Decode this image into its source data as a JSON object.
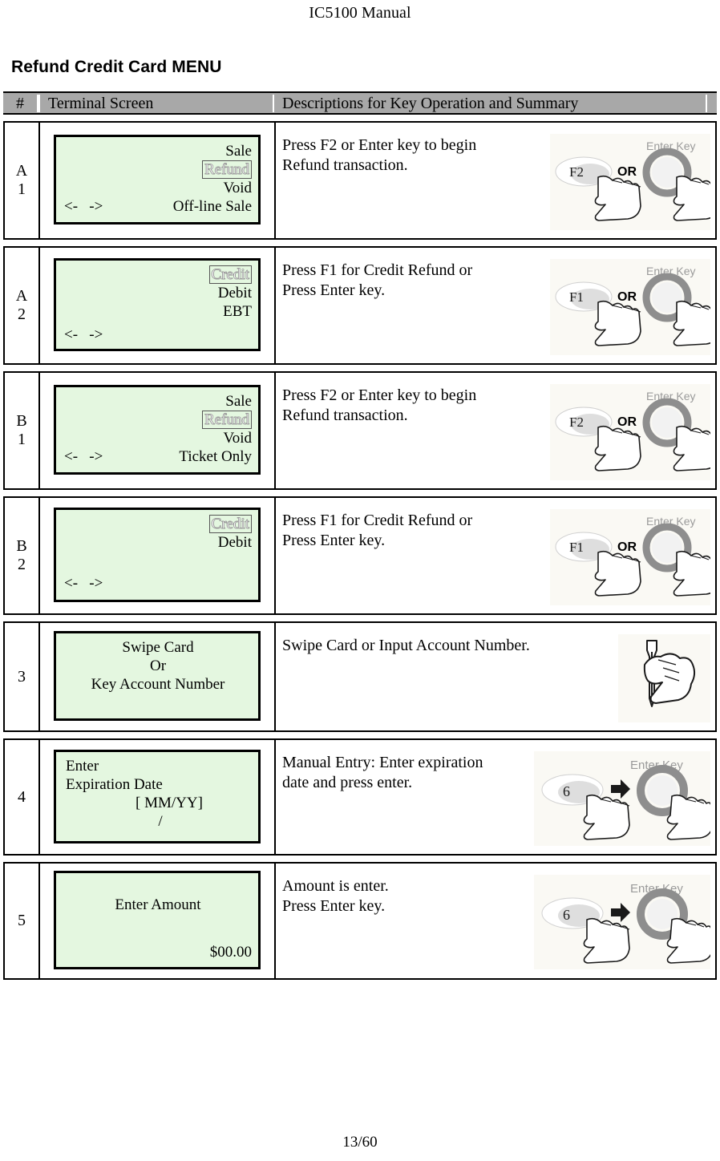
{
  "document": {
    "header_title": "IC5100 Manual",
    "page_title": "Refund Credit Card MENU",
    "footer": "13/60"
  },
  "table": {
    "columns": {
      "num": "#",
      "screen": "Terminal Screen",
      "description": "Descriptions for Key Operation and Summary"
    },
    "rows": [
      {
        "id": "A1",
        "num_line1": "A",
        "num_line2": "1",
        "screen": {
          "line1": "Sale",
          "line2_selected": "Refund",
          "line3": "Void",
          "nav_arrows": "<-   ->",
          "nav_label": "Off-line Sale"
        },
        "description": "Press F2 or Enter key to begin\nRefund transaction.",
        "illustration": {
          "type": "key-or-enter",
          "key_label": "F2",
          "connector": "OR",
          "enter_label": "Enter Key"
        }
      },
      {
        "id": "A2",
        "num_line1": "A",
        "num_line2": "2",
        "screen": {
          "line1_selected": "Credit",
          "line2": "Debit",
          "line3": "EBT",
          "nav_arrows": "<-   ->",
          "nav_label": ""
        },
        "description": "Press F1 for Credit Refund or\nPress Enter key.",
        "illustration": {
          "type": "key-or-enter",
          "key_label": "F1",
          "connector": "OR",
          "enter_label": "Enter Key"
        }
      },
      {
        "id": "B1",
        "num_line1": "B",
        "num_line2": "1",
        "screen": {
          "line1": "Sale",
          "line2_selected": "Refund",
          "line3": "Void",
          "nav_arrows": "<-   ->",
          "nav_label": "Ticket Only"
        },
        "description": "Press F2 or Enter key to begin\nRefund transaction.",
        "illustration": {
          "type": "key-or-enter",
          "key_label": "F2",
          "connector": "OR",
          "enter_label": "Enter Key"
        }
      },
      {
        "id": "B2",
        "num_line1": "B",
        "num_line2": "2",
        "screen": {
          "line1_selected": "Credit",
          "line2": "Debit",
          "line3": "",
          "nav_arrows": "<-   ->",
          "nav_label": ""
        },
        "description": "Press F1 for Credit Refund or\nPress Enter key.",
        "illustration": {
          "type": "key-or-enter",
          "key_label": "F1",
          "connector": "OR",
          "enter_label": "Enter Key"
        }
      },
      {
        "id": "3",
        "num_line1": "3",
        "num_line2": "",
        "screen": {
          "center_line1": "Swipe Card",
          "center_line2": "Or",
          "center_line3": "Key Account Number"
        },
        "description": "Swipe Card or Input Account Number.",
        "illustration": {
          "type": "swipe-hand"
        }
      },
      {
        "id": "4",
        "num_line1": "4",
        "num_line2": "",
        "screen": {
          "left_line1": "Enter",
          "left_line2": "Expiration Date",
          "center_line3": "[ MM/YY]",
          "center_line4": "/"
        },
        "description": "Manual Entry:  Enter expiration\ndate and press enter.",
        "illustration": {
          "type": "key-then-enter",
          "key_label": "6",
          "enter_label": "Enter Key"
        }
      },
      {
        "id": "5",
        "num_line1": "5",
        "num_line2": "",
        "screen": {
          "center_line1": "Enter Amount",
          "right_line2": "$00.00"
        },
        "description": "Amount is enter.\nPress Enter key.",
        "illustration": {
          "type": "key-then-enter",
          "key_label": "6",
          "enter_label": "Enter Key"
        }
      }
    ]
  },
  "colors": {
    "lcd_background": "#e4f7e0",
    "header_band": "#a8a8a8",
    "text": "#000000"
  }
}
